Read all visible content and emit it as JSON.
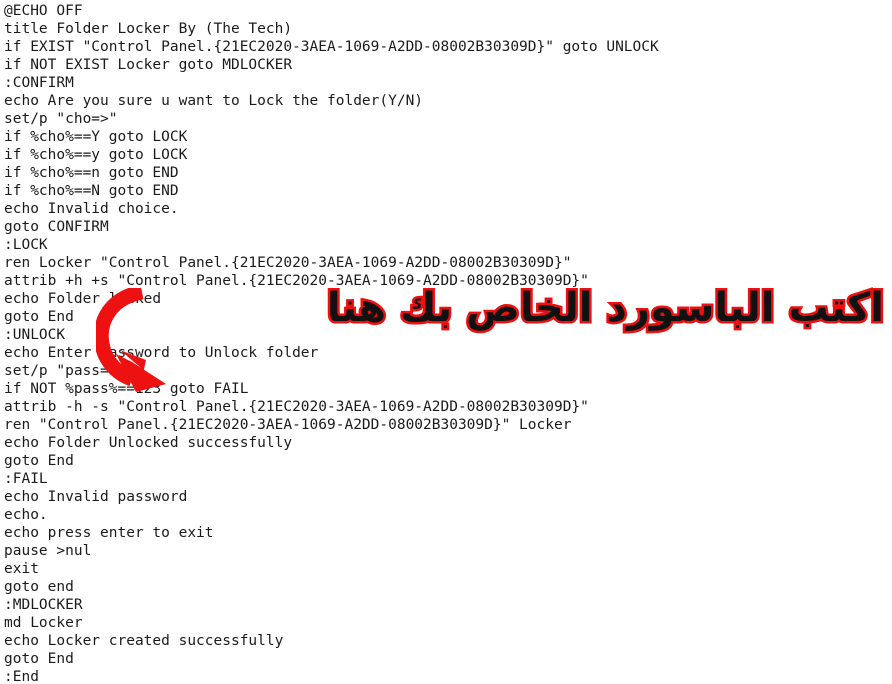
{
  "document": {
    "type": "batch-script",
    "background_color": "#ffffff",
    "text_color": "#1b1b1b",
    "lines": [
      "@ECHO OFF",
      "title Folder Locker By (The Tech)",
      "if EXIST \"Control Panel.{21EC2020-3AEA-1069-A2DD-08002B30309D}\" goto UNLOCK",
      "if NOT EXIST Locker goto MDLOCKER",
      ":CONFIRM",
      "echo Are you sure u want to Lock the folder(Y/N)",
      "set/p \"cho=>\"",
      "if %cho%==Y goto LOCK",
      "if %cho%==y goto LOCK",
      "if %cho%==n goto END",
      "if %cho%==N goto END",
      "echo Invalid choice.",
      "goto CONFIRM",
      ":LOCK",
      "ren Locker \"Control Panel.{21EC2020-3AEA-1069-A2DD-08002B30309D}\"",
      "attrib +h +s \"Control Panel.{21EC2020-3AEA-1069-A2DD-08002B30309D}\"",
      "echo Folder locked",
      "goto End",
      ":UNLOCK",
      "echo Enter password to Unlock folder",
      "set/p \"pass=\"",
      "if NOT %pass%==123 goto FAIL",
      "attrib -h -s \"Control Panel.{21EC2020-3AEA-1069-A2DD-08002B30309D}\"",
      "ren \"Control Panel.{21EC2020-3AEA-1069-A2DD-08002B30309D}\" Locker",
      "echo Folder Unlocked successfully",
      "goto End",
      ":FAIL",
      "echo Invalid password",
      "echo.",
      "echo press enter to exit",
      "pause >nul",
      "exit",
      "goto end",
      ":MDLOCKER",
      "md Locker",
      "echo Locker created successfully",
      "goto End",
      ":End"
    ]
  },
  "annotation": {
    "arabic_text": "اكتب الباسورد الخاص بك هنا",
    "arabic_translation_note": "Write your password here",
    "fill_color": "#111111",
    "outline_color": "#ee1111",
    "arrow": {
      "name": "curved-down-right-arrow",
      "color": "#ee1111",
      "points_to": "if NOT %pass%==123 goto FAIL"
    }
  }
}
